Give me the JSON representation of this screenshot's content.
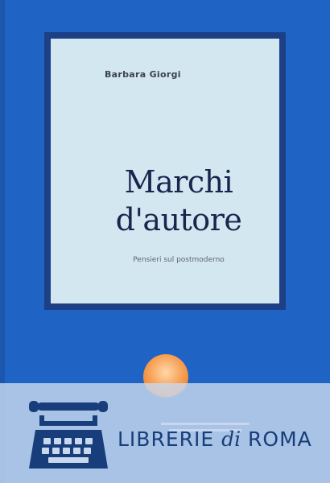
{
  "book": {
    "author": "Barbara Giorgi",
    "title_line1": "Marchi",
    "title_line2": "d'autore",
    "subtitle": "Pensieri sul postmoderno"
  },
  "watermark": {
    "brand_part1": "LIBRERIE ",
    "brand_part2": "di",
    "brand_part3": " ROMA",
    "icon": "typewriter-icon"
  },
  "colors": {
    "cover_blue": "#1f63c4",
    "frame_navy": "#1c3f86",
    "panel_light": "#d3e7f0",
    "title_ink": "#18264e",
    "logo_orange": "#f7a35a",
    "banner_text": "#173e7a"
  }
}
